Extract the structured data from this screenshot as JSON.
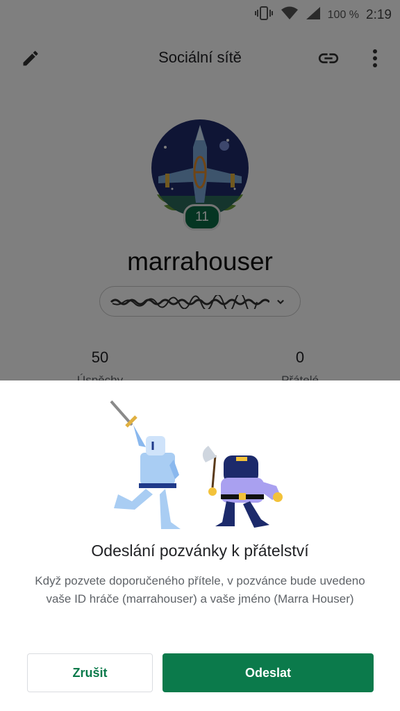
{
  "status_bar": {
    "battery": "100 %",
    "time": "2:19"
  },
  "app_bar": {
    "title": "Sociální sítě"
  },
  "profile": {
    "level": "11",
    "username": "marrahouser",
    "stats": [
      {
        "value": "50",
        "label": "Úspěchy"
      },
      {
        "value": "0",
        "label": "Přátelé"
      }
    ]
  },
  "dialog": {
    "title": "Odeslání pozvánky k přátelství",
    "body": "Když pozvete doporučeného přítele, v pozvánce bude uvedeno vaše ID hráče (marrahouser) a vaše jméno (Marra Houser)",
    "cancel_label": "Zrušit",
    "send_label": "Odeslat"
  },
  "colors": {
    "accent": "#0b7a4b",
    "badge": "#0b6a45",
    "scrim": "rgba(0,0,0,0.5)"
  }
}
